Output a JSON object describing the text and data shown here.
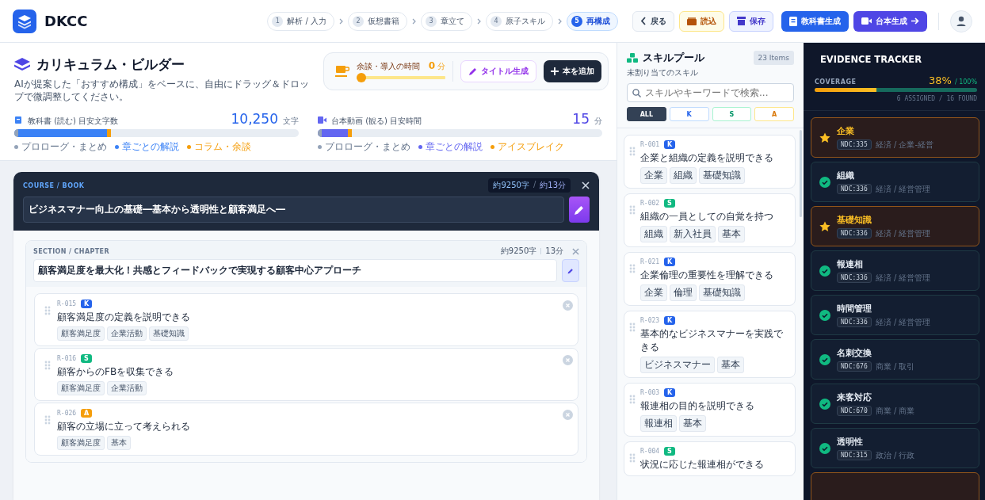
{
  "app": {
    "name": "DKCC"
  },
  "steps": [
    {
      "number": "1",
      "label": "解析 / 入力",
      "selected": false
    },
    {
      "number": "2",
      "label": "仮想書籍",
      "selected": false
    },
    {
      "number": "3",
      "label": "章立て",
      "selected": false
    },
    {
      "number": "4",
      "label": "原子スキル",
      "selected": false
    },
    {
      "number": "5",
      "label": "再構成",
      "selected": true
    }
  ],
  "toolbar": [
    {
      "kind": "back",
      "label": "戻る"
    },
    {
      "kind": "load",
      "label": "読込"
    },
    {
      "kind": "save",
      "label": "保存"
    },
    {
      "kind": "book",
      "label": "教科書生成"
    },
    {
      "kind": "video",
      "label": "台本生成"
    }
  ],
  "builder": {
    "title": "カリキュラム・ビルダー",
    "subtitle": "AIが提案した「おすすめ構成」をベースに、自由にドラッグ＆ドロップで微調整してください。",
    "intro_time": {
      "label": "余談・導入の時間",
      "value": "0",
      "unit": "分",
      "level": 0
    },
    "title_button": "タイトル生成",
    "add_button": "本を追加",
    "meters": [
      {
        "kind": "book",
        "label": "教科書 (読む) 目安文字数",
        "value": "10,250",
        "unit": "文字",
        "level": 0.34,
        "segments": [
          {
            "label": "プロローグ・まとめ",
            "color": "#94a3b8"
          },
          {
            "label": "章ごとの解説",
            "color": "#3b82f6"
          },
          {
            "label": "コラム・余談",
            "color": "#f59e0b"
          }
        ]
      },
      {
        "kind": "video",
        "label": "台本動画 (観る) 目安時間",
        "value": "15",
        "unit": "分",
        "level": 0.12,
        "segments": [
          {
            "label": "プロローグ・まとめ",
            "color": "#94a3b8"
          },
          {
            "label": "章ごとの解説",
            "color": "#6366f1"
          },
          {
            "label": "アイスブレイク",
            "color": "#f59e0b"
          }
        ]
      }
    ]
  },
  "course": {
    "label": "COURSE / BOOK",
    "chars": "約9250字",
    "separator": "/",
    "minutes": "約13分",
    "title": "ビジネスマナー向上の基礎―基本から透明性と顧客満足へ―",
    "section": {
      "label": "SECTION / CHAPTER",
      "chars": "約9250字",
      "minutes": "13分",
      "title": "顧客満足度を最大化！共感とフィードバックで実現する顧客中心アプローチ",
      "skills": [
        {
          "id": "R-015",
          "type": "K",
          "kind": "knowledge",
          "title": "顧客満足度の定義を説明できる",
          "tags": [
            "顧客満足度",
            "企業活動",
            "基礎知識"
          ]
        },
        {
          "id": "R-016",
          "type": "S",
          "kind": "skill",
          "title": "顧客からのFBを収集できる",
          "tags": [
            "顧客満足度",
            "企業活動"
          ]
        },
        {
          "id": "R-026",
          "type": "A",
          "kind": "attitude",
          "title": "顧客の立場に立って考えられる",
          "tags": [
            "顧客満足度",
            "基本"
          ]
        }
      ]
    }
  },
  "skill_pool": {
    "title": "スキルプール",
    "subtitle": "未割り当てのスキル",
    "count": "23 Items",
    "search": {
      "placeholder": "スキルやキーワードで検索..."
    },
    "filters": [
      {
        "label": "ALL",
        "kind": "all",
        "selected": true
      },
      {
        "label": "K",
        "kind": "knowledge",
        "selected": false
      },
      {
        "label": "S",
        "kind": "skill",
        "selected": false
      },
      {
        "label": "A",
        "kind": "attitude",
        "selected": false
      }
    ],
    "skills": [
      {
        "id": "R-001",
        "type": "K",
        "kind": "knowledge",
        "title": "企業と組織の定義を説明できる",
        "tags": [
          "企業",
          "組織",
          "基礎知識"
        ]
      },
      {
        "id": "R-002",
        "type": "S",
        "kind": "skill",
        "title": "組織の一員としての自覚を持つ",
        "tags": [
          "組織",
          "新入社員",
          "基本"
        ]
      },
      {
        "id": "R-021",
        "type": "K",
        "kind": "knowledge",
        "title": "企業倫理の重要性を理解できる",
        "tags": [
          "企業",
          "倫理",
          "基礎知識"
        ]
      },
      {
        "id": "R-023",
        "type": "K",
        "kind": "knowledge",
        "title": "基本的なビジネスマナーを実践できる",
        "tags": [
          "ビジネスマナー",
          "基本"
        ]
      },
      {
        "id": "R-003",
        "type": "K",
        "kind": "knowledge",
        "title": "報連相の目的を説明できる",
        "tags": [
          "報連相",
          "基本"
        ]
      },
      {
        "id": "R-004",
        "type": "S",
        "kind": "skill",
        "title": "状況に応じた報連相ができる"
      }
    ]
  },
  "evidence": {
    "title": "EVIDENCE TRACKER",
    "coverage_label": "COVERAGE",
    "percent": "38%",
    "total": "/ 100%",
    "level": 0.38,
    "summary": "6 ASSIGNED / 16 FOUND",
    "items": [
      {
        "kind": "highlight",
        "title": "企業",
        "code": "NDC:335",
        "category": "経済 / 企業-経営"
      },
      {
        "kind": "assigned",
        "title": "組織",
        "code": "NDC:336",
        "category": "経済 / 経営管理"
      },
      {
        "kind": "highlight",
        "title": "基礎知識",
        "code": "NDC:336",
        "category": "経済 / 経営管理"
      },
      {
        "kind": "assigned",
        "title": "報連相",
        "code": "NDC:336",
        "category": "経済 / 経営管理"
      },
      {
        "kind": "assigned",
        "title": "時間管理",
        "code": "NDC:336",
        "category": "経済 / 経営管理"
      },
      {
        "kind": "assigned",
        "title": "名刺交換",
        "code": "NDC:676",
        "category": "商業 / 取引"
      },
      {
        "kind": "assigned",
        "title": "来客対応",
        "code": "NDC:670",
        "category": "商業 / 商業"
      },
      {
        "kind": "assigned",
        "title": "透明性",
        "code": "NDC:315",
        "category": "政治 / 行政"
      },
      {
        "kind": "highlight"
      }
    ]
  }
}
